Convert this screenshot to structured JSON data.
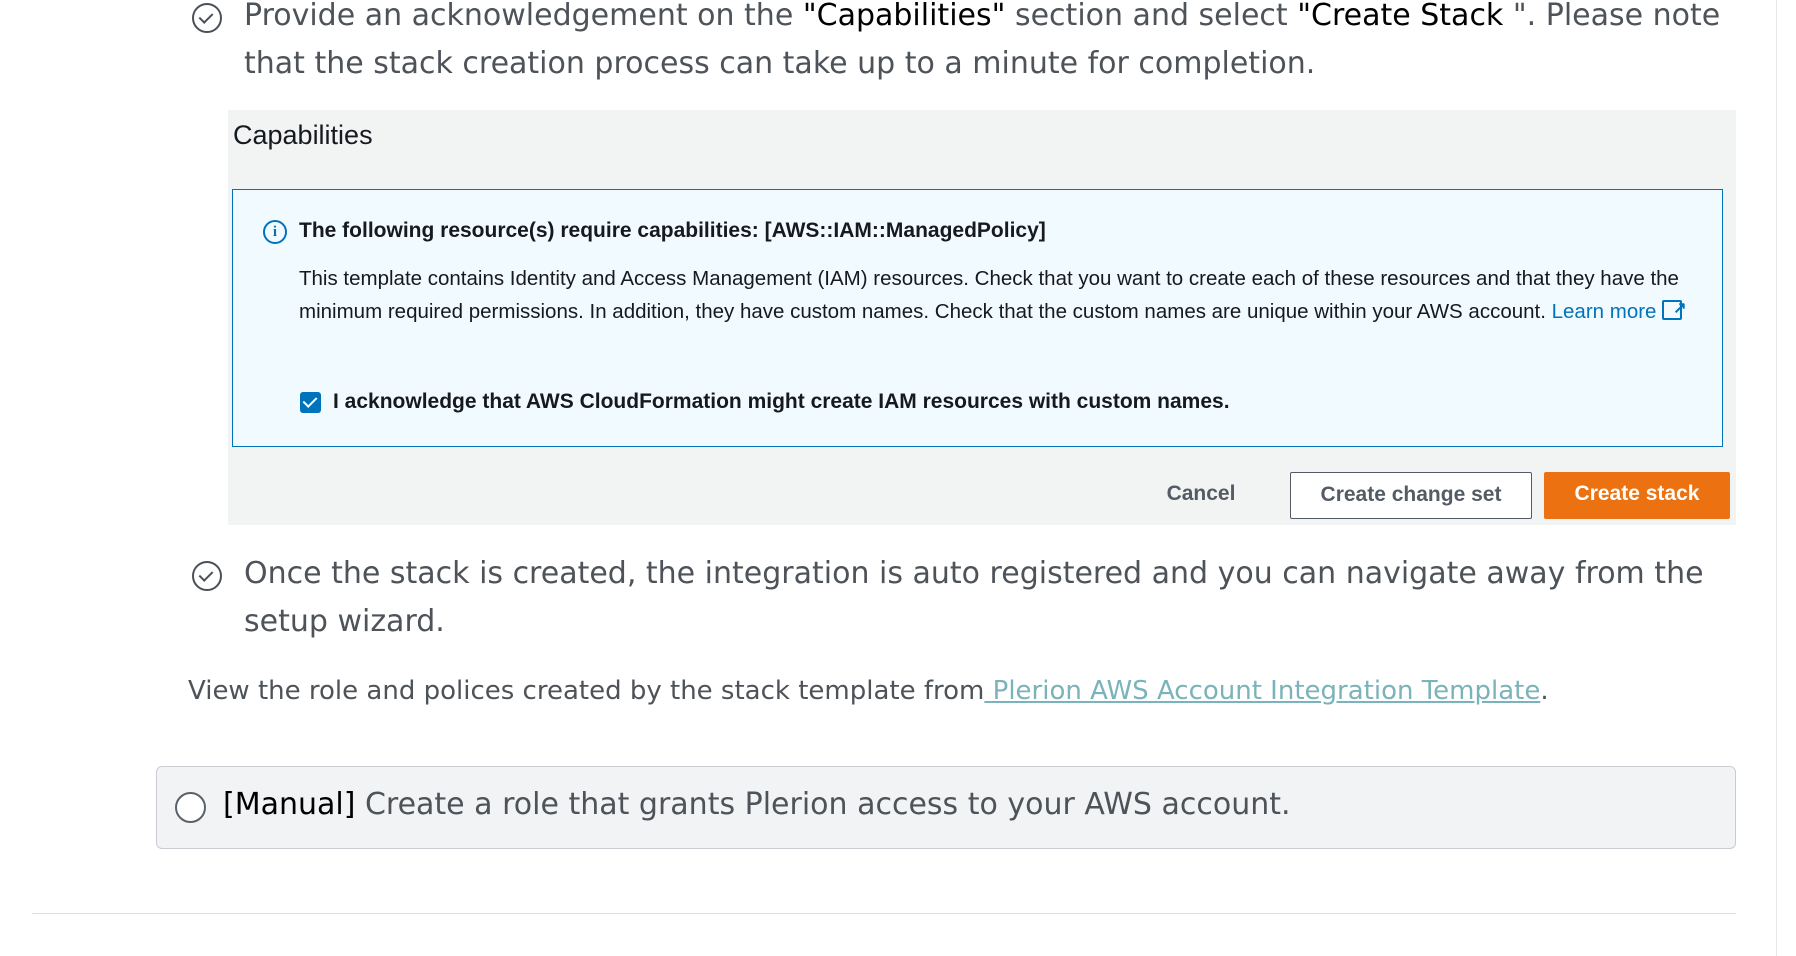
{
  "step1": {
    "prefix": "Provide an acknowledgement on the ",
    "q1": "\"",
    "highlight1": "Capabilities",
    "q2": "\"",
    "middle": " section and select ",
    "q3": "\"",
    "highlight2": "Create Stack ",
    "q4": "\"",
    "suffix": ". Please note that the stack creation process can take up to a minute for completion."
  },
  "capabilities": {
    "title": "Capabilities",
    "info_heading": "The following resource(s) require capabilities: [AWS::IAM::ManagedPolicy]",
    "info_body": "This template contains Identity and Access Management (IAM) resources. Check that you want to create each of these resources and that they have the minimum required permissions. In addition, they have custom names. Check that the custom names are unique within your AWS account. ",
    "learn_more": "Learn more",
    "ack_label": "I acknowledge that AWS CloudFormation might create IAM resources with custom names.",
    "ack_checked": true,
    "buttons": {
      "cancel": "Cancel",
      "change_set": "Create change set",
      "create": "Create stack"
    },
    "accent_color": "#0073bb",
    "primary_color": "#ec7211"
  },
  "step2": {
    "text": "Once the stack is created, the integration is auto registered and you can navigate away from the setup wizard."
  },
  "view_role": {
    "prefix": "View the role and polices created by the stack template from",
    "link": " Plerion AWS Account Integration Template",
    "suffix": "."
  },
  "manual_option": {
    "tag": "[Manual]",
    "text": " Create a role that grants Plerion access to your AWS account.",
    "selected": false
  },
  "icons": {
    "step": "check-circle-icon",
    "info": "info-icon",
    "external": "external-link-icon"
  }
}
